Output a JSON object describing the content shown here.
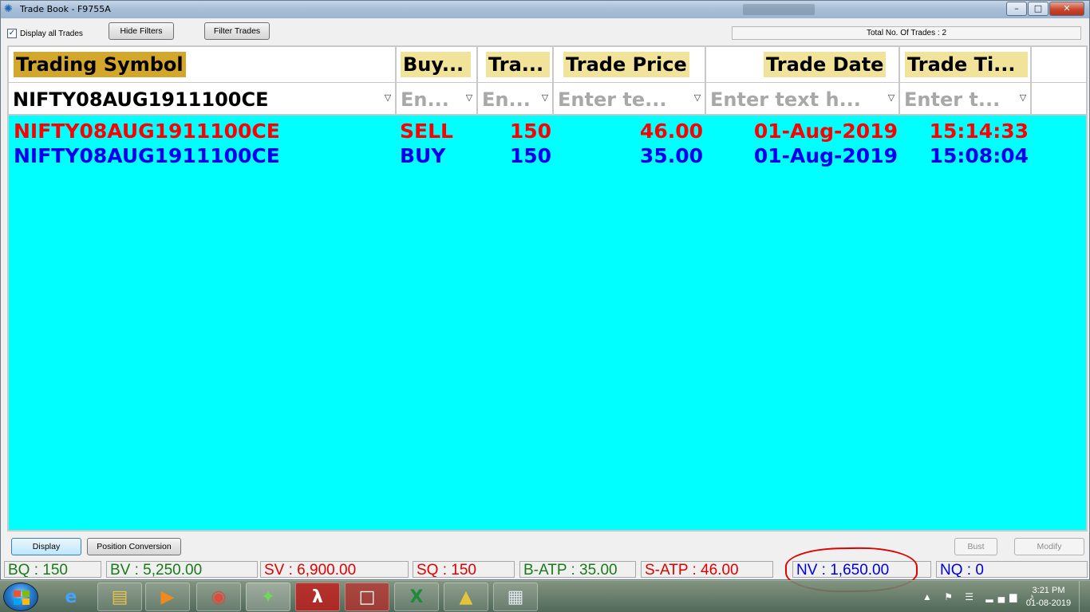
{
  "window": {
    "title": "Trade Book - F9755A",
    "min_glyph": "–",
    "max_glyph": "□",
    "close_glyph": "✕"
  },
  "toolbar": {
    "display_all_label": "Display all Trades",
    "display_all_checked": true,
    "check_glyph": "✓",
    "hide_filters_label": "Hide Filters",
    "filter_trades_label": "Filter Trades",
    "total_trades_text": "Total No. Of Trades : 2"
  },
  "grid": {
    "background_color": "#00ffff",
    "columns": [
      {
        "header": "Trading Symbol",
        "filter_text": "NIFTY08AUG1911100CE",
        "filter_active": true
      },
      {
        "header": "Buy...",
        "filter_text": "En...",
        "filter_active": false
      },
      {
        "header": "Tra...",
        "filter_text": "En...",
        "filter_active": false
      },
      {
        "header": "Trade Price",
        "filter_text": "Enter te...",
        "filter_active": false
      },
      {
        "header": "Trade Date",
        "filter_text": "Enter text h...",
        "filter_active": false
      },
      {
        "header": "Trade Ti...",
        "filter_text": "Enter t...",
        "filter_active": false
      }
    ],
    "filter_icon": "funnel-icon",
    "filter_glyph": "▽",
    "rows": [
      {
        "symbol": "NIFTY08AUG1911100CE",
        "side": "SELL",
        "qty": "150",
        "price": "46.00",
        "date": "01-Aug-2019",
        "time": "15:14:33",
        "color": "#ff0000"
      },
      {
        "symbol": "NIFTY08AUG1911100CE",
        "side": "BUY",
        "qty": "150",
        "price": "35.00",
        "date": "01-Aug-2019",
        "time": "15:08:04",
        "color": "#0000ee"
      }
    ]
  },
  "actions": {
    "display_label": "Display",
    "position_conversion_label": "Position Conversion",
    "bust_label": "Bust",
    "modify_label": "Modify"
  },
  "status": {
    "bq": "BQ : 150",
    "bv": "BV : 5,250.00",
    "sv": "SV : 6,900.00",
    "sq": "SQ : 150",
    "b_atp": "B-ATP : 35.00",
    "s_atp": "S-ATP : 46.00",
    "nv": "NV : 1,650.00",
    "nq": "NQ : 0",
    "colors": {
      "green": "#1a7a1a",
      "red": "#e00000",
      "blue": "#0000dd"
    }
  },
  "taskbar": {
    "items": [
      "ie-icon",
      "file-explorer-icon",
      "media-player-icon",
      "chrome-icon",
      "trading-app-icon",
      "acrobat-icon",
      "presentation-icon",
      "excel-icon",
      "triangle-app-icon",
      "calculator-icon"
    ],
    "tray_glyphs": "▲ ⚑ ☰ ▂▄▆ ♪",
    "time": "3:21 PM",
    "date": "01-08-2019"
  }
}
